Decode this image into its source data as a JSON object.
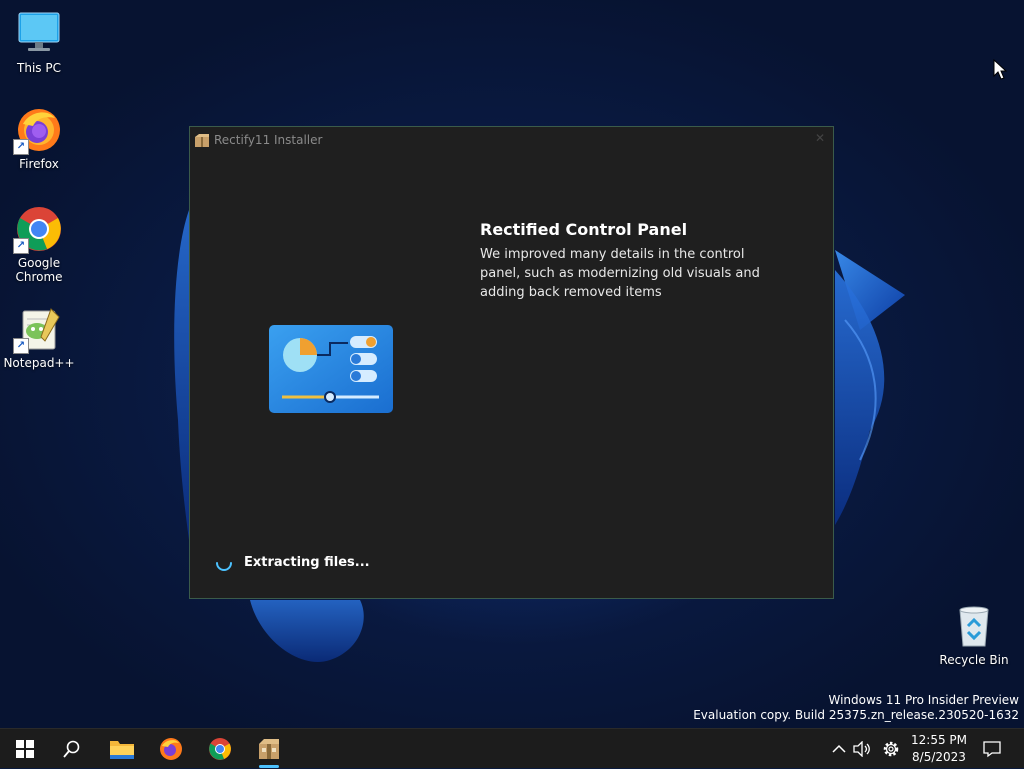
{
  "desktop": {
    "icons": [
      {
        "label": "This PC"
      },
      {
        "label": "Firefox"
      },
      {
        "label": "Google Chrome"
      },
      {
        "label": "Notepad++"
      },
      {
        "label": "Recycle Bin"
      }
    ],
    "watermark": {
      "line1": "Windows 11 Pro Insider Preview",
      "line2": "Evaluation copy. Build 25375.zn_release.230520-1632"
    }
  },
  "installer": {
    "title": "Rectify11 Installer",
    "close_glyph": "✕",
    "heading": "Rectified Control Panel",
    "description": "We improved many details in the control panel, such as modernizing old visuals and adding back removed items",
    "status": "Extracting files..."
  },
  "taskbar": {
    "clock_time": "12:55 PM",
    "clock_date": "8/5/2023",
    "pinned": [
      "start-icon",
      "search-icon",
      "file-explorer-icon",
      "firefox-icon",
      "chrome-icon",
      "rectify11-installer-icon"
    ],
    "active_app": "rectify11-installer-icon"
  },
  "colors": {
    "accent": "#4cc2ff",
    "window_bg": "#1f1f1f",
    "taskbar_bg": "#1c1c1c"
  }
}
